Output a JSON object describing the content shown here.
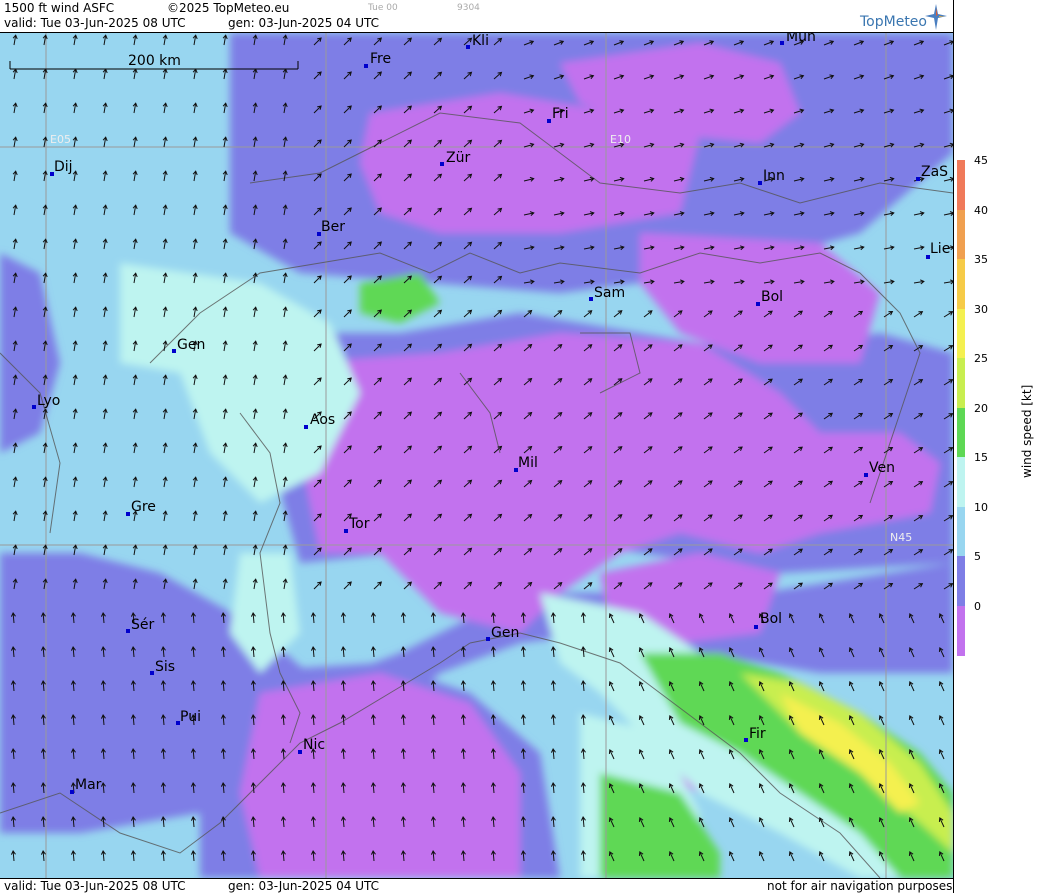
{
  "header": {
    "product": "1500 ft wind ASFC",
    "copyright": "©2025 TopMeteo.eu",
    "valid_line": "valid:  Tue  03-Jun-2025  08 UTC",
    "gen_line": "gen: 03-Jun-2025 04 UTC",
    "faint_1": "Tue 00",
    "faint_2": "9304",
    "logo": "TopMeteo"
  },
  "footer": {
    "valid_line": "valid:  Tue  03-Jun-2025  08 UTC",
    "gen_line": "gen: 03-Jun-2025 04 UTC",
    "disclaimer": "not for air navigation purposes"
  },
  "map": {
    "scale_label": "200 km",
    "grid_labels": [
      "E05",
      "E10",
      "N45"
    ],
    "cities": [
      "Kli",
      "Mün",
      "Fre",
      "Fri",
      "Dij",
      "Zür",
      "Inn",
      "ZaS",
      "Ber",
      "Lie",
      "Sam",
      "Bol",
      "Gen",
      "Lyo",
      "Aos",
      "Ven",
      "Mil",
      "Gre",
      "Tor",
      "Sér",
      "Gen",
      "Bol",
      "Sis",
      "Pui",
      "Fir",
      "Nic",
      "Mar"
    ]
  },
  "colorbar": {
    "title": "wind speed [kt]",
    "ticks": [
      "45",
      "40",
      "35",
      "30",
      "25",
      "20",
      "15",
      "10",
      "5",
      "0"
    ],
    "colors": [
      "#f07a5a",
      "#f0a050",
      "#f6cb48",
      "#f4f050",
      "#c8ee50",
      "#5ed855",
      "#bef4f0",
      "#98d6f0",
      "#7e7ee6",
      "#c272ee"
    ]
  }
}
